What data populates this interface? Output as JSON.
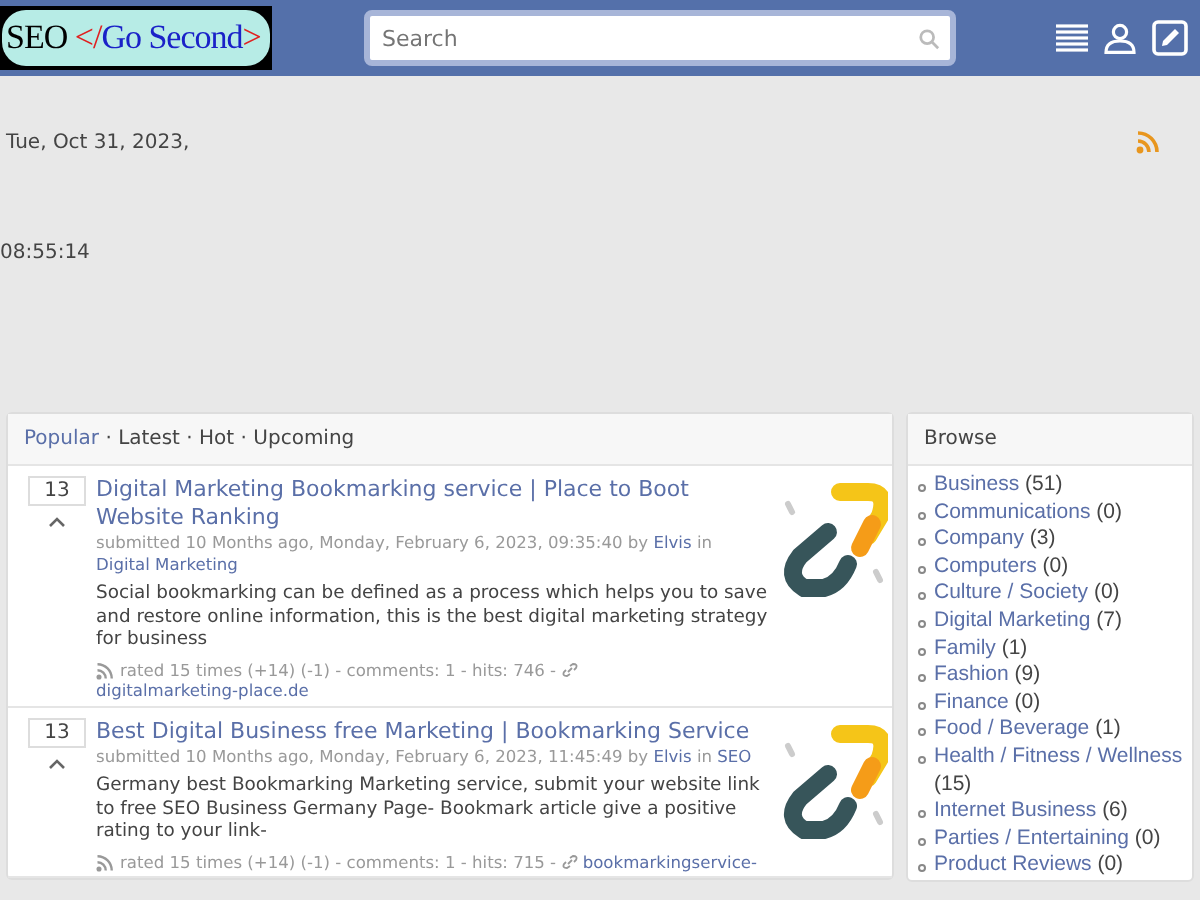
{
  "header": {
    "logo": [
      {
        "text": "SEO ",
        "kind": "plain"
      },
      {
        "text": "</",
        "kind": "mark"
      },
      {
        "text": "Go Second",
        "kind": "accent"
      },
      {
        "text": ">",
        "kind": "mark"
      }
    ],
    "search": {
      "placeholder": "Search"
    }
  },
  "date": "Tue, Oct 31, 2023,",
  "time": "08:55:14",
  "tab_separator": "·",
  "tabs": [
    {
      "label": "Popular",
      "selected": true
    },
    {
      "label": "Latest",
      "selected": false
    },
    {
      "label": "Hot",
      "selected": false
    },
    {
      "label": "Upcoming",
      "selected": false
    }
  ],
  "posts": [
    {
      "votes": "13",
      "title": "Digital Marketing Bookmarking service | Place to Boot Website Ranking",
      "submitted": "submitted 10 Months ago, Monday, February 6, 2023, 09:35:40 by",
      "author": "Elvis",
      "in": "in",
      "category": "Digital Marketing",
      "summary": "Social bookmarking can be defined as a process which helps you to save and restore online information, this is the best digital marketing strategy for business",
      "stats": "rated 15 times (+14)  (-1) - comments: 1 - hits: 746 -",
      "link": "digitalmarketing-place.de"
    },
    {
      "votes": "13",
      "title": "Best Digital Business free Marketing | Bookmarking Service",
      "submitted": "submitted 10 Months ago, Monday, February 6, 2023, 11:45:49 by",
      "author": "Elvis",
      "in": "in",
      "category": "SEO",
      "summary": "Germany best Bookmarking Marketing service, submit your website link to free SEO Business Germany Page- Bookmark article give a positive rating to your link-",
      "stats": "rated 15 times (+14)  (-1) - comments: 1 - hits: 715 -",
      "link": "bookmarkingservice-"
    }
  ],
  "browse": {
    "title": "Browse",
    "items": [
      {
        "name": "Business",
        "count": "(51)"
      },
      {
        "name": "Communications",
        "count": "(0)"
      },
      {
        "name": "Company",
        "count": "(3)"
      },
      {
        "name": "Computers",
        "count": "(0)"
      },
      {
        "name": "Culture / Society",
        "count": "(0)"
      },
      {
        "name": "Digital Marketing",
        "count": "(7)"
      },
      {
        "name": "Family",
        "count": "(1)"
      },
      {
        "name": "Fashion",
        "count": "(9)"
      },
      {
        "name": "Finance",
        "count": "(0)"
      },
      {
        "name": "Food / Beverage",
        "count": "(1)"
      },
      {
        "name": "Health / Fitness / Wellness",
        "count": "(15)"
      },
      {
        "name": "Internet Business",
        "count": "(6)"
      },
      {
        "name": "Parties / Entertaining",
        "count": "(0)"
      },
      {
        "name": "Product Reviews",
        "count": "(0)"
      }
    ]
  }
}
